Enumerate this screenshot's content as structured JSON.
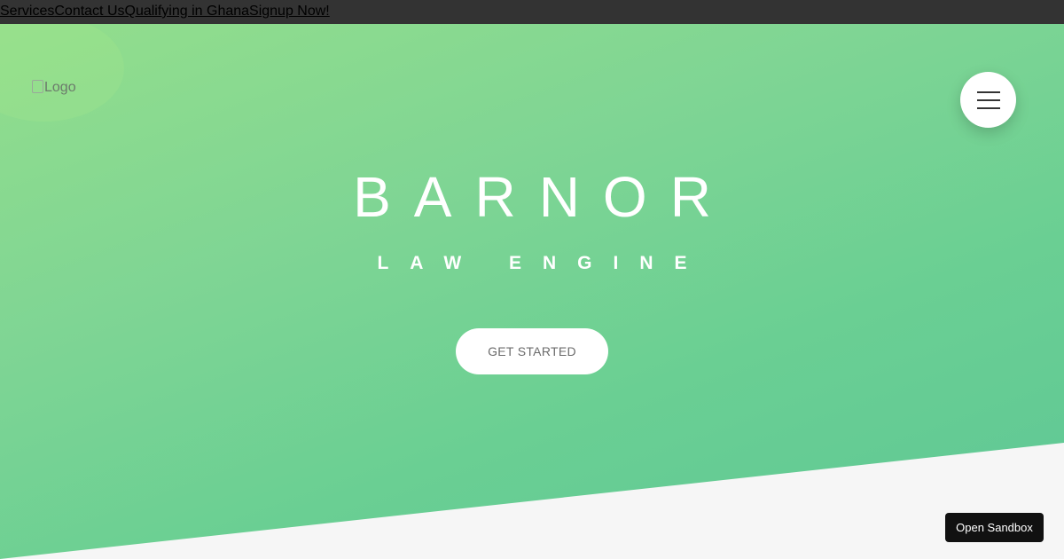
{
  "topnav": {
    "links": [
      "Services",
      "Contact Us",
      "Qualifying in Ghana",
      "Signup Now!"
    ]
  },
  "logo": {
    "alt": "Logo"
  },
  "hero": {
    "title": "BARNOR",
    "subtitle": "LAW ENGINE",
    "cta_label": "GET STARTED"
  },
  "sandbox": {
    "label": "Open Sandbox"
  },
  "colors": {
    "gradient_start": "#93de8c",
    "gradient_end": "#5ec796",
    "topbar": "#333333",
    "button_bg": "#ffffff",
    "sandbox_bg": "#111111"
  },
  "icons": {
    "menu": "hamburger-menu-icon",
    "logo": "broken-image-icon"
  }
}
